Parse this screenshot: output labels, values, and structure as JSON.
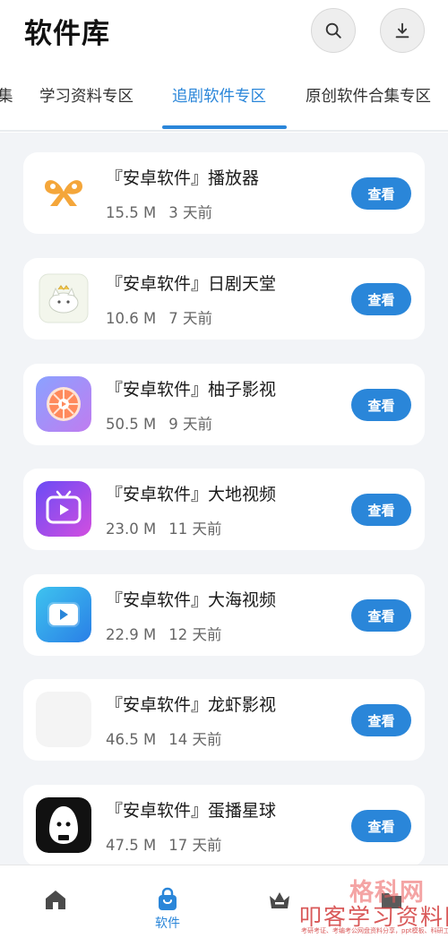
{
  "header": {
    "title": "软件库",
    "search_icon": "search-icon",
    "download_icon": "download-icon"
  },
  "tabs": [
    {
      "label": "集",
      "active": false
    },
    {
      "label": "学习资料专区",
      "active": false
    },
    {
      "label": "追剧软件专区",
      "active": true
    },
    {
      "label": "原创软件合集专区",
      "active": false
    }
  ],
  "apps": [
    {
      "name": "『安卓软件』播放器",
      "size": "15.5 M",
      "time": "3 天前",
      "button": "查看",
      "icon": "butterfly-player-icon"
    },
    {
      "name": "『安卓软件』日剧天堂",
      "size": "10.6 M",
      "time": "7 天前",
      "button": "查看",
      "icon": "cat-bun-icon"
    },
    {
      "name": "『安卓软件』柚子影视",
      "size": "50.5 M",
      "time": "9 天前",
      "button": "查看",
      "icon": "grapefruit-play-icon"
    },
    {
      "name": "『安卓软件』大地视频",
      "size": "23.0 M",
      "time": "11 天前",
      "button": "查看",
      "icon": "tv-play-icon"
    },
    {
      "name": "『安卓软件』大海视频",
      "size": "22.9 M",
      "time": "12 天前",
      "button": "查看",
      "icon": "blue-play-icon"
    },
    {
      "name": "『安卓软件』龙虾影视",
      "size": "46.5 M",
      "time": "14 天前",
      "button": "查看",
      "icon": "blank-icon"
    },
    {
      "name": "『安卓软件』蛋播星球",
      "size": "47.5 M",
      "time": "17 天前",
      "button": "查看",
      "icon": "egg-character-icon"
    }
  ],
  "bottom_nav": {
    "home_icon": "home-icon",
    "software_icon": "shopping-bag-icon",
    "software_label": "软件",
    "crown_icon": "crown-icon",
    "fourth_icon": "folder-icon"
  },
  "watermark": {
    "top": "格科网",
    "main": "叩客学习资料网",
    "sub": "考研考证、考编考公网盘资料分享，ppt模板、科研工具箱"
  },
  "colors": {
    "accent": "#2a86d9",
    "background": "#f2f4f7",
    "card": "#ffffff"
  }
}
